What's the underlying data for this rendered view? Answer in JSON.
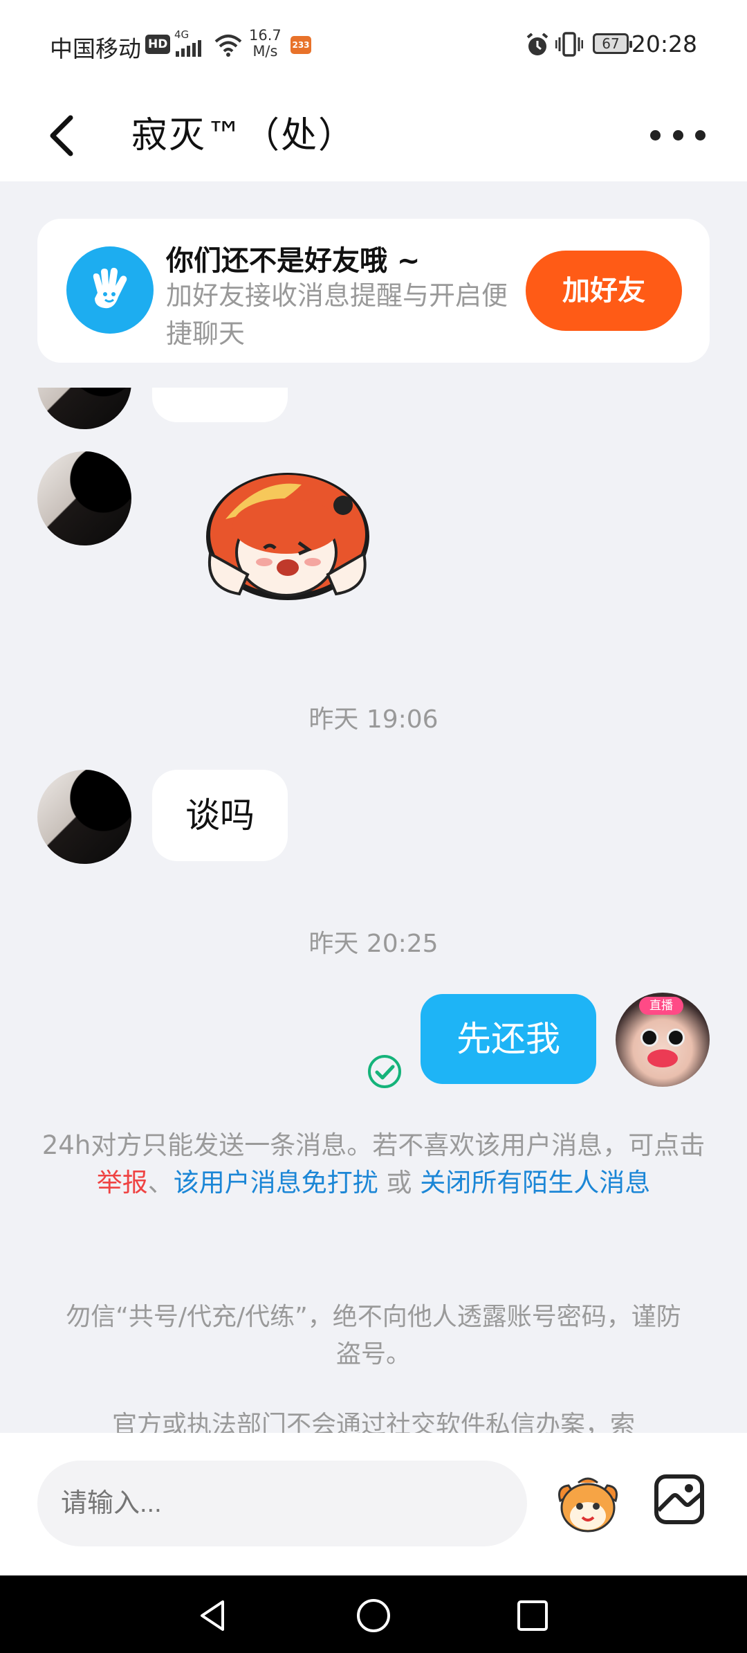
{
  "status_bar": {
    "carrier": "中国移动",
    "hd_badge": "HD",
    "network": "4G",
    "speed_value": "16.7",
    "speed_unit": "M/s",
    "app_badge": "233",
    "battery": "67",
    "time": "20:28"
  },
  "header": {
    "title": "寂灭™（处）"
  },
  "friend_card": {
    "title": "你们还不是好友哦 ~",
    "subtitle": "加好友接收消息提醒与开启便捷聊天",
    "add_button": "加好友"
  },
  "messages": {
    "timestamp_1": "昨天 19:06",
    "incoming_text": "谈吗",
    "timestamp_2": "昨天 20:25",
    "outgoing_text": "先还我",
    "live_badge": "直播"
  },
  "notice": {
    "line_start": "24h对方只能发送一条消息。若不喜欢该用户消息，可点击 ",
    "report_link": "举报",
    "sep": "、",
    "mute_link": "该用户消息免打扰",
    "or_text": " 或 ",
    "close_link": "关闭所有陌生人消息"
  },
  "warnings": {
    "warning_1": "勿信“共号/代充/代练”，绝不向他人透露账号密码，谨防盗号。",
    "warning_2": "官方或执法部门不会通过社交软件私信办案，索"
  },
  "input": {
    "placeholder": "请输入..."
  },
  "colors": {
    "accent_orange": "#ff5b16",
    "bubble_blue": "#1eb4f6",
    "link_blue": "#1b86d6",
    "report_red": "#ef4343"
  }
}
